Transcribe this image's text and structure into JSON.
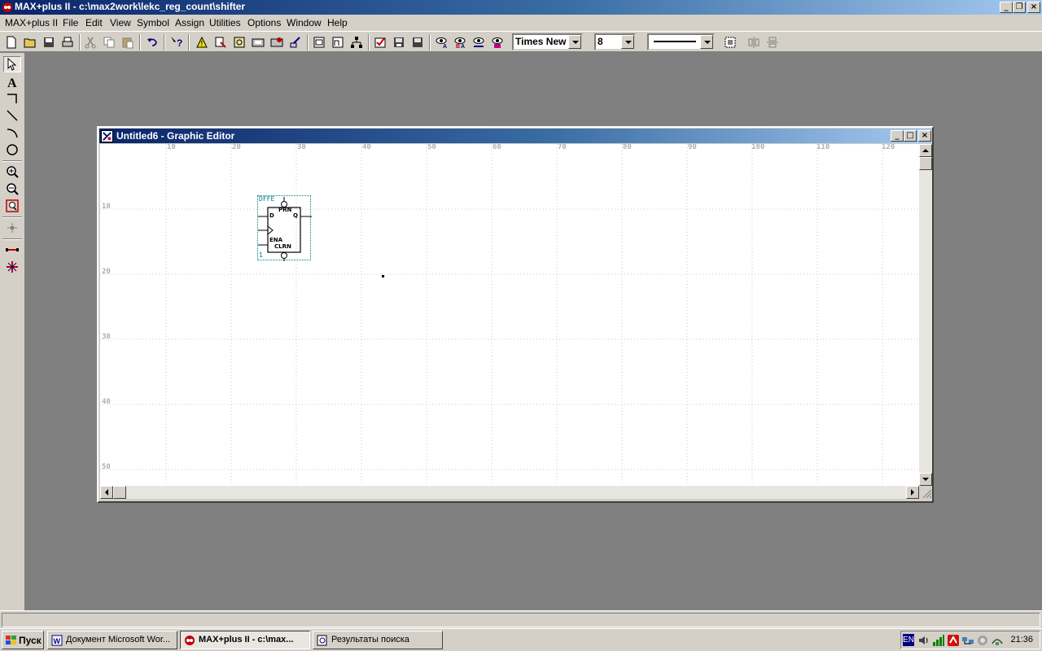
{
  "app": {
    "title": "MAX+plus II - c:\\max2work\\lekc_reg_count\\shifter"
  },
  "menu": [
    "MAX+plus II",
    "File",
    "Edit",
    "View",
    "Symbol",
    "Assign",
    "Utilities",
    "Options",
    "Window",
    "Help"
  ],
  "toolbar": {
    "font_name": "Times New",
    "font_size": "8",
    "line_style": "solid-line"
  },
  "child_window": {
    "title": "Untitled6 - Graphic Editor",
    "ruler_top": [
      "10",
      "20",
      "30",
      "40",
      "50",
      "60",
      "70",
      "80",
      "90",
      "100",
      "110",
      "120"
    ],
    "ruler_left": [
      "10",
      "20",
      "30",
      "40",
      "50"
    ]
  },
  "symbol": {
    "name": "DFFE",
    "pins": {
      "prn": "PRN",
      "d": "D",
      "q": "Q",
      "ena": "ENA",
      "clrn": "CLRN"
    },
    "instance": "1"
  },
  "taskbar": {
    "start": "Пуск",
    "tasks": [
      "Документ Microsoft Wor...",
      "MAX+plus II - c:\\max...",
      "Результаты поиска"
    ],
    "lang": "EN",
    "clock": "21:36"
  }
}
